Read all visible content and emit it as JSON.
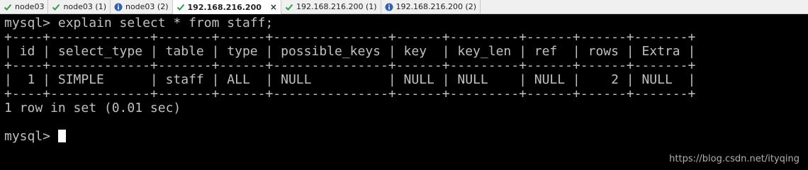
{
  "tabs": [
    {
      "label": "node03",
      "status_icon": "check-icon",
      "status_color": "#2ea043"
    },
    {
      "label": "node03 (1)",
      "status_icon": "check-icon",
      "status_color": "#2ea043"
    },
    {
      "label": "node03 (2)",
      "status_icon": "info-icon",
      "status_color": "#3060b0"
    },
    {
      "label": "192.168.216.200",
      "status_icon": "check-icon",
      "status_color": "#2ea043",
      "active": true,
      "close_label": "×"
    },
    {
      "label": "192.168.216.200 (1)",
      "status_icon": "check-icon",
      "status_color": "#2ea043"
    },
    {
      "label": "192.168.216.200 (2)",
      "status_icon": "info-icon",
      "status_color": "#3060b0"
    }
  ],
  "terminal": {
    "command_line": "mysql> explain select * from staff;",
    "table_border": "+----+-------------+-------+------+---------------+------+---------+------+------+-------+",
    "header_row": "| id | select_type | table | type | possible_keys | key  | key_len | ref  | rows | Extra |",
    "data_row": "|  1 | SIMPLE      | staff | ALL  | NULL          | NULL | NULL    | NULL |    2 | NULL  |",
    "result_line": "1 row in set (0.01 sec)",
    "prompt": "mysql> "
  },
  "watermark": "https://blog.csdn.net/ityqing"
}
